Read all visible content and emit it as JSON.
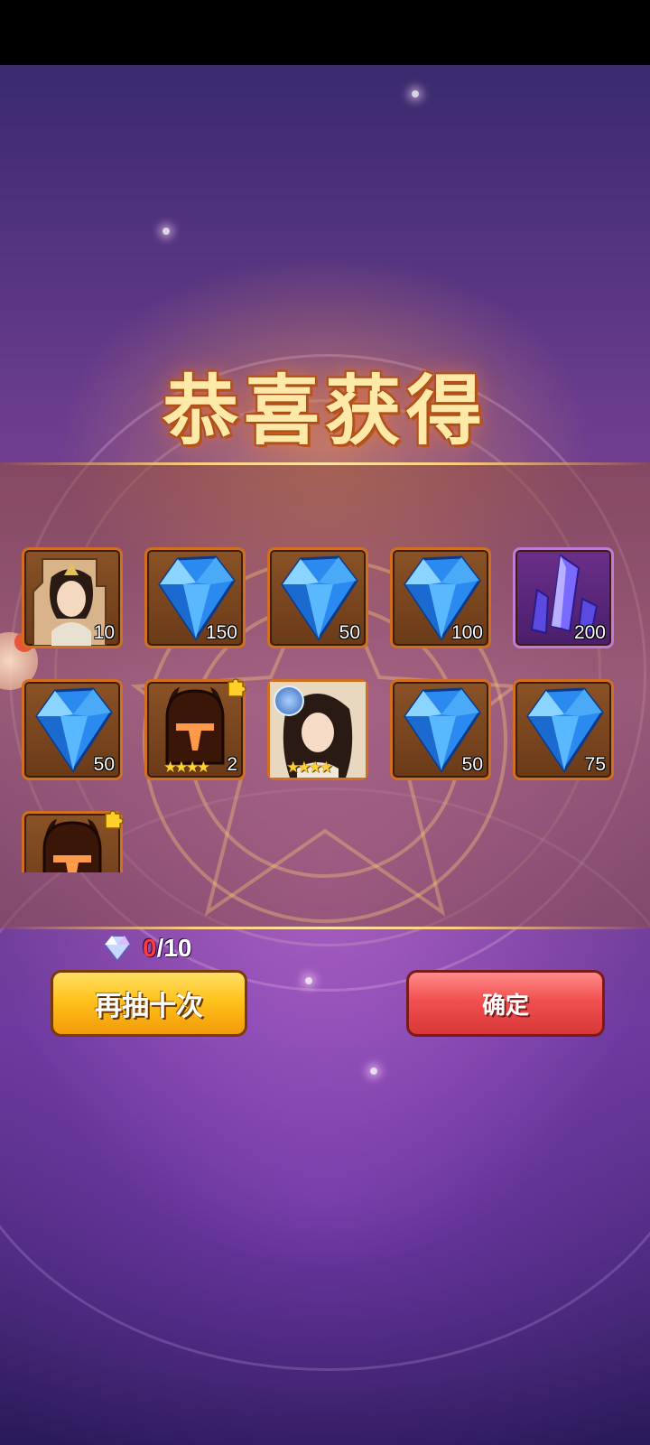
{
  "title": "恭喜获得",
  "rewards": [
    {
      "type": "hero-shard",
      "icon": "hero-portrait-icon",
      "quantity": "10"
    },
    {
      "type": "blue-gem",
      "icon": "blue-diamond-icon",
      "quantity": "150"
    },
    {
      "type": "blue-gem",
      "icon": "blue-diamond-icon",
      "quantity": "50"
    },
    {
      "type": "blue-gem",
      "icon": "blue-diamond-icon",
      "quantity": "100"
    },
    {
      "type": "purple-crystal",
      "icon": "purple-crystal-icon",
      "quantity": "200"
    },
    {
      "type": "blue-gem",
      "icon": "blue-diamond-icon",
      "quantity": "50"
    },
    {
      "type": "helmet-shard",
      "icon": "dark-helmet-icon",
      "quantity": "2",
      "stars": 4
    },
    {
      "type": "hero-card",
      "icon": "hero-portrait-icon",
      "stars": 4
    },
    {
      "type": "blue-gem",
      "icon": "blue-diamond-icon",
      "quantity": "50"
    },
    {
      "type": "blue-gem",
      "icon": "blue-diamond-icon",
      "quantity": "75"
    },
    {
      "type": "helmet-shard",
      "icon": "dark-helmet-icon"
    }
  ],
  "cost": {
    "current": "0",
    "total": "/10",
    "icon": "crystal-icon"
  },
  "buttons": {
    "draw_again": "再抽十次",
    "confirm": "确定"
  },
  "colors": {
    "title": "#ffe9a8",
    "draw_again": "#ffc21a",
    "confirm": "#f25050",
    "cost_current": "#ff3a3a"
  }
}
